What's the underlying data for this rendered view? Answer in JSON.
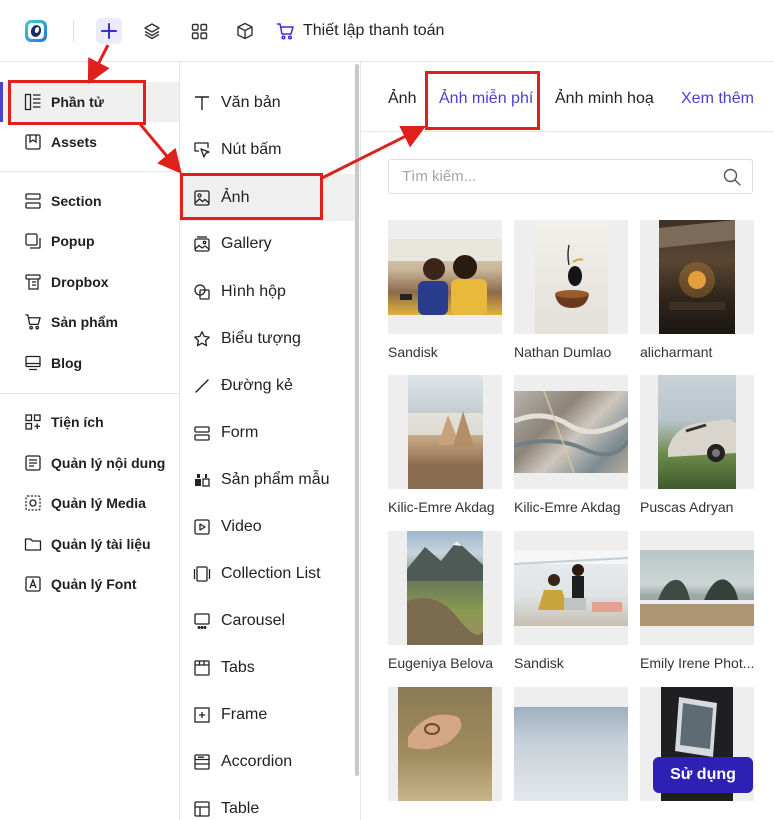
{
  "topbar": {
    "checkout_label": "Thiết lập thanh toán"
  },
  "sidebar": {
    "group1": [
      {
        "label": "Phần tử",
        "icon": "elements-icon"
      },
      {
        "label": "Assets",
        "icon": "assets-icon"
      }
    ],
    "group2": [
      {
        "label": "Section",
        "icon": "section-icon"
      },
      {
        "label": "Popup",
        "icon": "popup-icon"
      },
      {
        "label": "Dropbox",
        "icon": "dropbox-icon"
      },
      {
        "label": "Sản phẩm",
        "icon": "cart-icon"
      },
      {
        "label": "Blog",
        "icon": "blog-icon"
      }
    ],
    "group3": [
      {
        "label": "Tiện ích",
        "icon": "widgets-icon"
      },
      {
        "label": "Quản lý nội dung",
        "icon": "content-icon"
      },
      {
        "label": "Quản lý Media",
        "icon": "media-icon"
      },
      {
        "label": "Quản lý tài liệu",
        "icon": "folder-icon"
      },
      {
        "label": "Quản lý Font",
        "icon": "font-icon"
      }
    ]
  },
  "elements": [
    {
      "label": "Văn bản",
      "icon": "text-icon"
    },
    {
      "label": "Nút bấm",
      "icon": "button-cursor-icon"
    },
    {
      "label": "Ảnh",
      "icon": "image-icon"
    },
    {
      "label": "Gallery",
      "icon": "gallery-icon"
    },
    {
      "label": "Hình hộp",
      "icon": "shape-icon"
    },
    {
      "label": "Biểu tượng",
      "icon": "star-icon"
    },
    {
      "label": "Đường kẻ",
      "icon": "line-icon"
    },
    {
      "label": "Form",
      "icon": "form-icon"
    },
    {
      "label": "Sản phẩm mẫu",
      "icon": "product-sample-icon"
    },
    {
      "label": "Video",
      "icon": "video-icon"
    },
    {
      "label": "Collection List",
      "icon": "collection-icon"
    },
    {
      "label": "Carousel",
      "icon": "carousel-icon"
    },
    {
      "label": "Tabs",
      "icon": "tabs-icon"
    },
    {
      "label": "Frame",
      "icon": "frame-icon"
    },
    {
      "label": "Accordion",
      "icon": "accordion-icon"
    },
    {
      "label": "Table",
      "icon": "table-icon"
    }
  ],
  "panel": {
    "tabs": [
      {
        "label": "Ảnh"
      },
      {
        "label": "Ảnh miễn phí"
      },
      {
        "label": "Ảnh minh hoạ"
      }
    ],
    "more_label": "Xem thêm",
    "search_placeholder": "Tìm kiếm...",
    "images": [
      {
        "author": "Sandisk"
      },
      {
        "author": "Nathan Dumlao"
      },
      {
        "author": "alicharmant"
      },
      {
        "author": "Kilic-Emre Akdag"
      },
      {
        "author": "Kilic-Emre Akdag"
      },
      {
        "author": "Puscas Adryan"
      },
      {
        "author": "Eugeniya Belova"
      },
      {
        "author": "Sandisk"
      },
      {
        "author": "Emily Irene Phot..."
      }
    ],
    "use_label": "Sử dụng"
  },
  "colors": {
    "accent": "#4a3fd1",
    "primary_button": "#2e1fb5",
    "annotation": "#e0201b"
  }
}
